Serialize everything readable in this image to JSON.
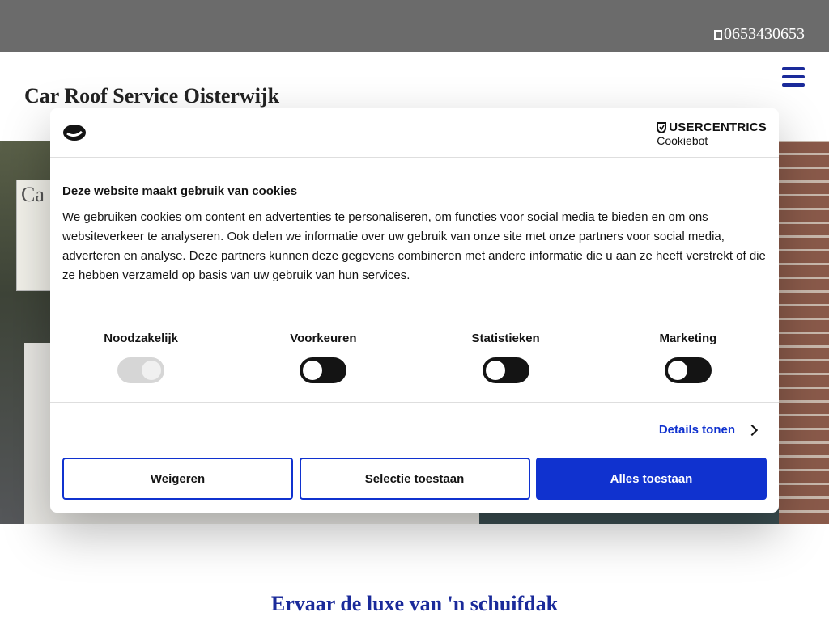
{
  "topbar": {
    "phone": "0653430653",
    "phone_icon": "phone-icon"
  },
  "header": {
    "site_title": "Car Roof Service Oisterwijk",
    "menu_icon": "hamburger-icon"
  },
  "hero": {
    "sign_text": "Ca"
  },
  "tagline": "Ervaar de luxe van 'n schuifdak",
  "cookie": {
    "brand": "USERCENTRICS",
    "brand_sub": "Cookiebot",
    "title": "Deze website maakt gebruik van cookies",
    "text": "We gebruiken cookies om content en advertenties te personaliseren, om functies voor social media te bieden en om ons websiteverkeer te analyseren. Ook delen we informatie over uw gebruik van onze site met onze partners voor social media, adverteren en analyse. Deze partners kunnen deze gegevens combineren met andere informatie die u aan ze heeft verstrekt of die ze hebben verzameld op basis van uw gebruik van hun services.",
    "categories": [
      {
        "label": "Noodzakelijk",
        "enabled": true,
        "disabled": true
      },
      {
        "label": "Voorkeuren",
        "enabled": false,
        "disabled": false
      },
      {
        "label": "Statistieken",
        "enabled": false,
        "disabled": false
      },
      {
        "label": "Marketing",
        "enabled": false,
        "disabled": false
      }
    ],
    "details_label": "Details tonen",
    "buttons": {
      "reject": "Weigeren",
      "selection": "Selectie toestaan",
      "accept_all": "Alles toestaan"
    },
    "colors": {
      "accent": "#1032cf",
      "toggle_off": "#141414"
    }
  }
}
